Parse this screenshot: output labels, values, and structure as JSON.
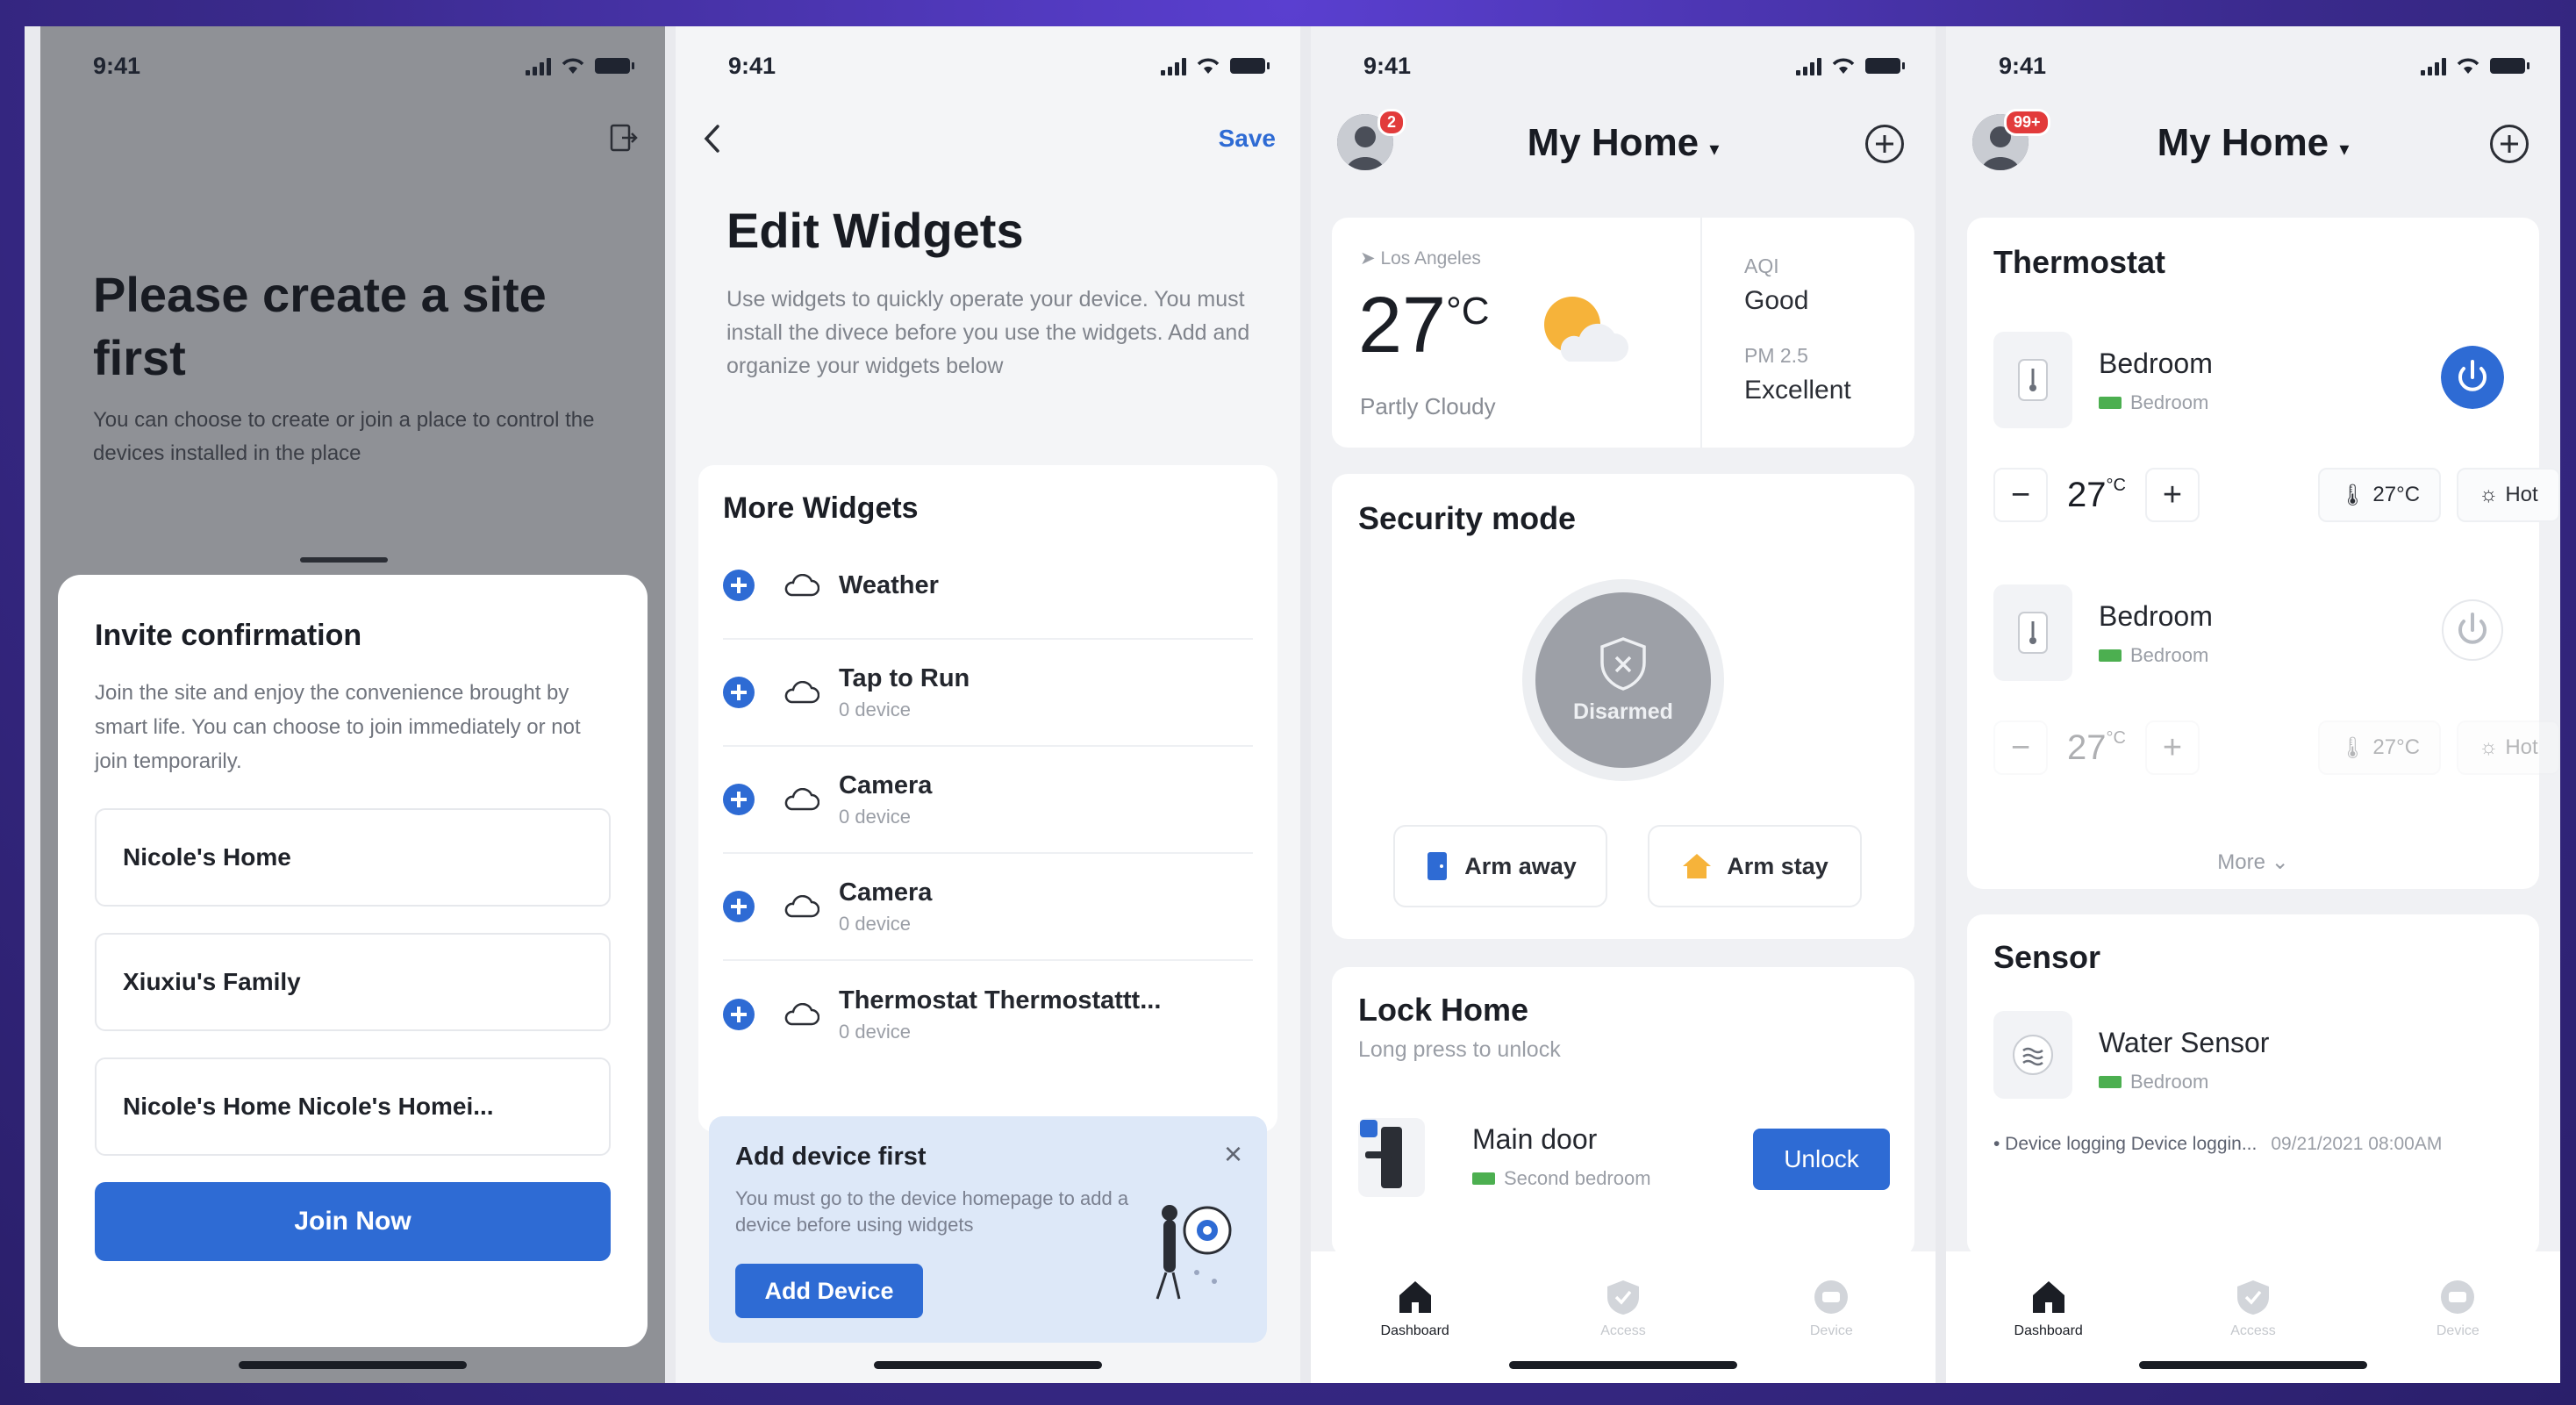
{
  "status": {
    "time": "9:41"
  },
  "screen1": {
    "title": "Please create a site first",
    "subtitle": "You can choose to create or join a place to control the devices installed in the place",
    "sheet_title": "Invite confirmation",
    "sheet_text": "Join the site and enjoy the convenience brought by smart life. You can choose to join immediately or not join temporarily.",
    "options": [
      "Nicole's Home",
      "Xiuxiu's Family",
      "Nicole's Home Nicole's Homei..."
    ],
    "join_label": "Join Now"
  },
  "screen2": {
    "save_label": "Save",
    "title": "Edit Widgets",
    "subtitle": "Use widgets to quickly operate your device. You must install the divece before you use the widgets. Add and organize your widgets below",
    "section_title": "More Widgets",
    "widgets": [
      {
        "name": "Weather",
        "sub": ""
      },
      {
        "name": "Tap to Run",
        "sub": "0 device"
      },
      {
        "name": "Camera",
        "sub": "0 device"
      },
      {
        "name": "Camera",
        "sub": "0 device"
      },
      {
        "name": "Thermostat Thermostattt...",
        "sub": "0 device"
      }
    ],
    "banner_title": "Add device first",
    "banner_text": "You must go to the device homepage to add a device before using widgets",
    "banner_button": "Add Device"
  },
  "screen3": {
    "badge": "2",
    "home_title": "My Home",
    "weather": {
      "location": "Los Angeles",
      "temp": "27",
      "unit": "°C",
      "condition": "Partly Cloudy",
      "aqi_label": "AQI",
      "aqi_value": "Good",
      "pm_label": "PM 2.5",
      "pm_value": "Excellent"
    },
    "security": {
      "title": "Security mode",
      "state": "Disarmed",
      "arm_away": "Arm away",
      "arm_stay": "Arm stay"
    },
    "lock": {
      "title": "Lock Home",
      "subtitle": "Long press to unlock",
      "device": "Main door",
      "room": "Second bedroom",
      "action": "Unlock"
    },
    "tabs": [
      "Dashboard",
      "Access",
      "Device"
    ]
  },
  "screen4": {
    "badge": "99+",
    "home_title": "My Home",
    "thermostat_title": "Thermostat",
    "thermostats": [
      {
        "name": "Bedroom",
        "room": "Bedroom",
        "temp": "27",
        "unit": "°C",
        "ambient": "27°C",
        "mode": "Hot",
        "power": "on"
      },
      {
        "name": "Bedroom",
        "room": "Bedroom",
        "temp": "27",
        "unit": "°C",
        "ambient": "27°C",
        "mode": "Hot",
        "power": "off"
      }
    ],
    "more_label": "More",
    "sensor_title": "Sensor",
    "sensor": {
      "name": "Water Sensor",
      "room": "Bedroom",
      "log": "• Device logging Device loggin...",
      "time": "09/21/2021 08:00AM"
    },
    "tabs": [
      "Dashboard",
      "Access",
      "Device"
    ]
  },
  "colors": {
    "accent": "#2e6bd4",
    "background": "#3b2a8e",
    "alert": "#e23b3b"
  }
}
